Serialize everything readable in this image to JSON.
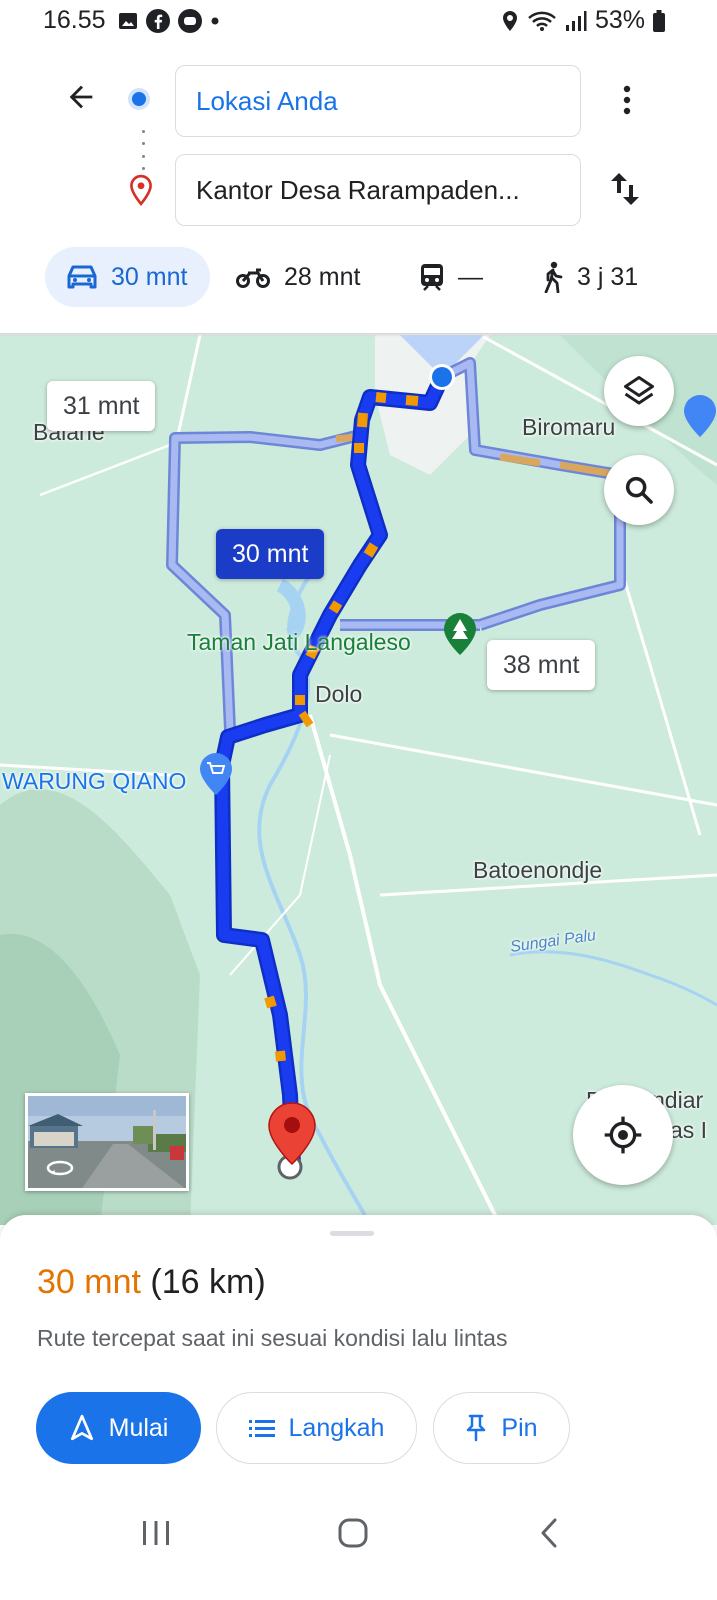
{
  "status_bar": {
    "time": "16.55",
    "battery": "53%",
    "icons_left": [
      "gallery-icon",
      "facebook-icon",
      "chat-bubble-icon",
      "dot-icon"
    ],
    "icons_right": [
      "location-icon",
      "wifi-icon",
      "signal-icon",
      "battery-icon"
    ]
  },
  "directions": {
    "origin": "Lokasi Anda",
    "destination": "Kantor Desa Rarampaden..."
  },
  "travel_modes": [
    {
      "mode": "car",
      "icon": "car-icon",
      "label": "30 mnt",
      "selected": true
    },
    {
      "mode": "motorcycle",
      "icon": "motorcycle-icon",
      "label": "28 mnt",
      "selected": false
    },
    {
      "mode": "transit",
      "icon": "train-icon",
      "label": "—",
      "selected": false
    },
    {
      "mode": "walk",
      "icon": "walk-icon",
      "label": "3 j 31",
      "selected": false
    }
  ],
  "map": {
    "labels": {
      "balane": "Balane",
      "biromaru": "Biromaru",
      "taman": "Taman Jati Langaleso",
      "dolo": "Dolo",
      "warung": "WARUNG QIANO",
      "batoenondje": "Batoenondje",
      "sungai": "Sungai Palu",
      "edge1": "B",
      "edge2": "ndiar",
      "edge3": "as I"
    },
    "route_chips": {
      "alt1": "31 mnt",
      "main": "30 mnt",
      "alt2": "38 mnt"
    },
    "colors": {
      "route_main": "#1a3cf0",
      "route_alt": "#a9b9f2",
      "traffic": "#f29900",
      "destination_pin": "#ea4335"
    }
  },
  "sheet": {
    "duration": "30 mnt",
    "distance": "(16 km)",
    "subtitle": "Rute tercepat saat ini sesuai kondisi lalu lintas",
    "start_label": "Mulai",
    "steps_label": "Langkah",
    "pin_label": "Pin"
  }
}
